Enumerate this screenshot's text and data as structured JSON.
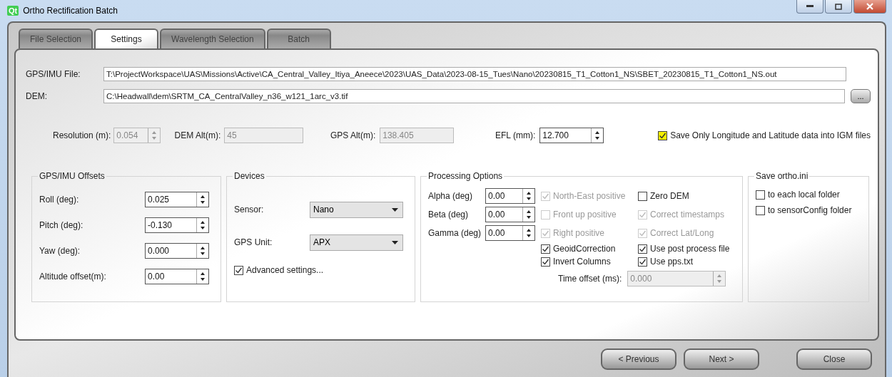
{
  "window": {
    "logo": "Qt",
    "title": "Ortho Rectification Batch"
  },
  "tabs": [
    {
      "label": "File Selection",
      "selected": false
    },
    {
      "label": "Settings",
      "selected": true
    },
    {
      "label": "Wavelength Selection",
      "selected": false
    },
    {
      "label": "Batch",
      "selected": false
    }
  ],
  "file_fields": [
    {
      "label": "GPS/IMU File:",
      "value": "T:\\ProjectWorkspace\\UAS\\Missions\\Active\\CA_Central_Valley_Itiya_Aneece\\2023\\UAS_Data\\2023-08-15_Tues\\Nano\\20230815_T1_Cotton1_NS\\SBET_20230815_T1_Cotton1_NS.out"
    },
    {
      "label": "DEM:",
      "value": "C:\\Headwall\\dem\\SRTM_CA_CentralValley_n36_w121_1arc_v3.tif",
      "browse": "..."
    }
  ],
  "params": [
    {
      "kind": "spin",
      "label": "Resolution (m):",
      "value": "0.054",
      "disabled": true
    },
    {
      "kind": "text",
      "label": "DEM Alt(m):",
      "value": "45",
      "disabled": true
    },
    {
      "kind": "text",
      "label": "GPS Alt(m):",
      "value": "138.405",
      "disabled": true
    },
    {
      "kind": "spin",
      "label": "EFL (mm):",
      "value": "12.700",
      "disabled": false
    }
  ],
  "save_lonlat": {
    "label": "Save Only Longitude and  Latitude data  into IGM files",
    "checked": true,
    "highlighted": true
  },
  "offsets": {
    "title": "GPS/IMU Offsets",
    "fields": [
      {
        "label": "Roll (deg):",
        "value": "0.025"
      },
      {
        "label": "Pitch (deg):",
        "value": "-0.130"
      },
      {
        "label": "Yaw (deg):",
        "value": "0.000"
      },
      {
        "label": "Altitude offset(m):",
        "value": "0.00"
      }
    ]
  },
  "devices": {
    "title": "Devices",
    "selects": [
      {
        "label": "Sensor:",
        "value": "Nano"
      },
      {
        "label": "GPS Unit:",
        "value": "APX"
      }
    ],
    "advanced": {
      "label": "Advanced settings...",
      "checked": true
    }
  },
  "processing": {
    "title": "Processing Options",
    "rows": [
      {
        "angle": {
          "label": "Alpha (deg)",
          "value": "0.00"
        },
        "options": [
          {
            "label": "North-East positive",
            "checked": true,
            "disabled": true
          },
          {
            "label": "Zero DEM",
            "checked": false,
            "disabled": false
          }
        ]
      },
      {
        "angle": {
          "label": "Beta (deg)",
          "value": "0.00"
        },
        "options": [
          {
            "label": "Front up positive",
            "checked": false,
            "disabled": true
          },
          {
            "label": "Correct timestamps",
            "checked": true,
            "disabled": true
          }
        ]
      },
      {
        "angle": {
          "label": "Gamma (deg)",
          "value": "0.00"
        },
        "options": [
          {
            "label": "Right positive",
            "checked": true,
            "disabled": true
          },
          {
            "label": "Correct Lat/Long",
            "checked": true,
            "disabled": true
          }
        ]
      },
      {
        "options": [
          {
            "label": "GeoidCorrection",
            "checked": true,
            "disabled": false
          },
          {
            "label": "Use post process file",
            "checked": true,
            "disabled": false
          }
        ]
      },
      {
        "options": [
          {
            "label": "Invert Columns",
            "checked": true,
            "disabled": false
          },
          {
            "label": "Use pps.txt",
            "checked": true,
            "disabled": false
          }
        ]
      }
    ],
    "time_offset": {
      "label": "Time offset (ms):",
      "value": "0.000",
      "disabled": true
    }
  },
  "save_ini": {
    "title": "Save ortho.ini",
    "options": [
      {
        "label": "to each local folder",
        "checked": false
      },
      {
        "label": "to sensorConfig folder",
        "checked": false
      }
    ]
  },
  "buttons": [
    {
      "label": "< Previous"
    },
    {
      "label": "Next >"
    },
    {
      "label": "Close"
    }
  ]
}
